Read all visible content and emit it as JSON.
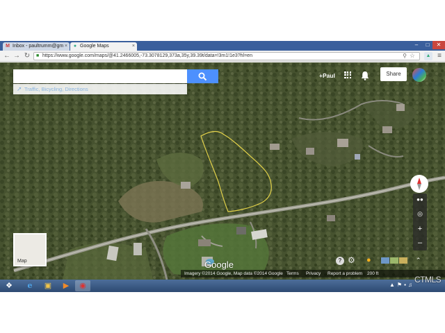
{
  "browser": {
    "tabs": [
      {
        "label": "Inbox - paultrumm@gm"
      },
      {
        "label": "Google Maps"
      }
    ],
    "close_glyph": "×",
    "url": "https://www.google.com/maps/@41.2466005,-73.3078129,373a,35y,39.39t/data=!3m1!1e3?hl=en",
    "icons": [
      "back-arrow-icon",
      "forward-arrow-icon",
      "reload-icon",
      "lock-icon",
      "search-icon",
      "star-icon",
      "menu-icon"
    ]
  },
  "maps": {
    "search": {
      "placeholder": "",
      "value": ""
    },
    "directions_label": "Traffic, Bicycling, Directions",
    "user_name": "+Paul",
    "share_label": "Share",
    "minimap_label": "Map",
    "logo_text": "Google",
    "footer": {
      "imagery": "Imagery ©2014 Google, Map data ©2014 Google",
      "terms": "Terms",
      "privacy": "Privacy",
      "report": "Report a problem",
      "scale": "200 ft"
    },
    "accent_color": "#4d90fe",
    "boundary_color": "#e3d24a"
  },
  "watermark": "CTMLS"
}
